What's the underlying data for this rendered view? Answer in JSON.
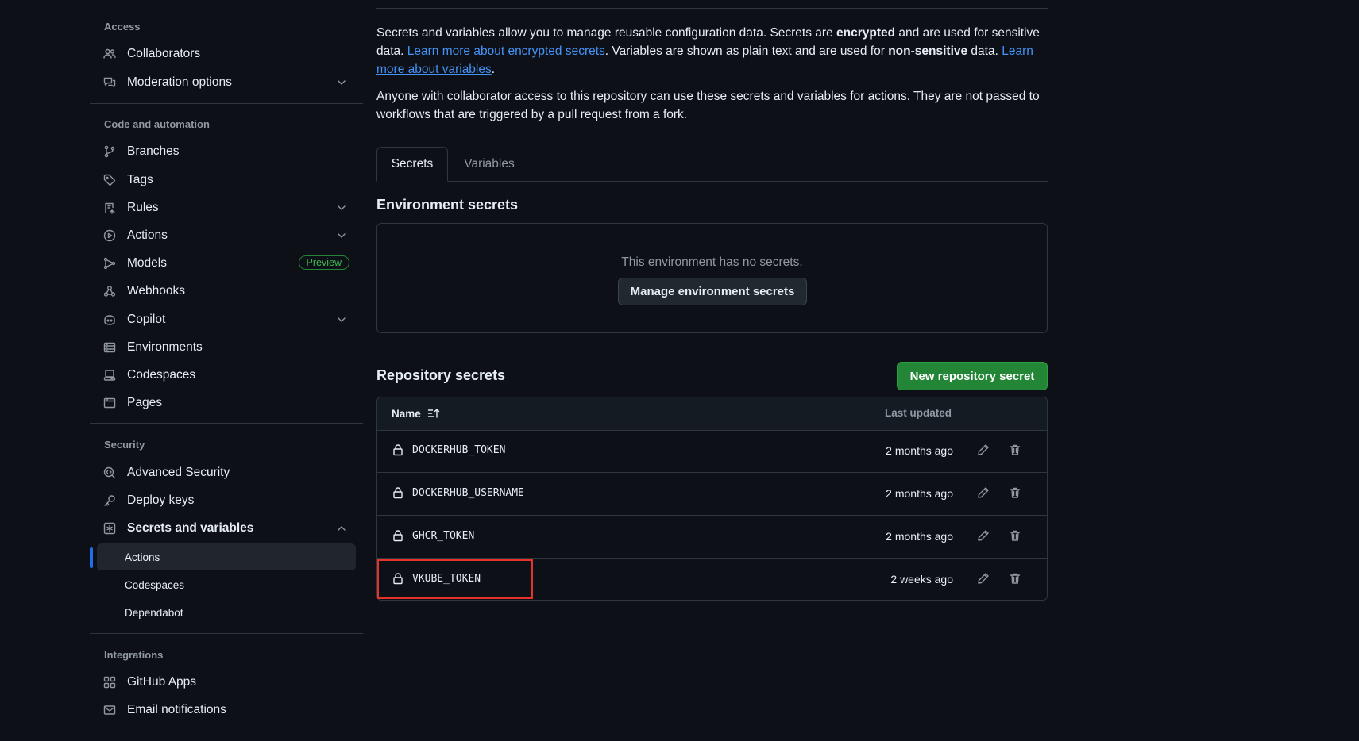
{
  "sidebar": {
    "sections": {
      "access": "Access",
      "code_automation": "Code and automation",
      "security": "Security",
      "integrations": "Integrations"
    },
    "items": {
      "collaborators": "Collaborators",
      "moderation": "Moderation options",
      "branches": "Branches",
      "tags": "Tags",
      "rules": "Rules",
      "actions": "Actions",
      "models": "Models",
      "models_badge": "Preview",
      "webhooks": "Webhooks",
      "copilot": "Copilot",
      "environments": "Environments",
      "codespaces": "Codespaces",
      "pages": "Pages",
      "advanced_security": "Advanced Security",
      "deploy_keys": "Deploy keys",
      "secrets_variables": "Secrets and variables",
      "sub_actions": "Actions",
      "sub_codespaces": "Codespaces",
      "sub_dependabot": "Dependabot",
      "github_apps": "GitHub Apps",
      "email_notifications": "Email notifications"
    }
  },
  "intro": {
    "p1_a": "Secrets and variables allow you to manage reusable configuration data. Secrets are ",
    "p1_b": "encrypted",
    "p1_c": " and are used for sensitive data. ",
    "p1_link1": "Learn more about encrypted secrets",
    "p1_d": ". Variables are shown as plain text and are used for ",
    "p1_e": "non-sensitive",
    "p1_f": " data. ",
    "p1_link2": "Learn more about variables",
    "p1_g": ".",
    "p2": "Anyone with collaborator access to this repository can use these secrets and variables for actions. They are not passed to workflows that are triggered by a pull request from a fork."
  },
  "tabs": {
    "secrets": "Secrets",
    "variables": "Variables"
  },
  "environment": {
    "title": "Environment secrets",
    "empty": "This environment has no secrets.",
    "manage_button": "Manage environment secrets"
  },
  "repository": {
    "title": "Repository secrets",
    "new_button": "New repository secret",
    "columns": {
      "name": "Name",
      "updated": "Last updated"
    },
    "rows": [
      {
        "name": "DOCKERHUB_TOKEN",
        "updated": "2 months ago"
      },
      {
        "name": "DOCKERHUB_USERNAME",
        "updated": "2 months ago"
      },
      {
        "name": "GHCR_TOKEN",
        "updated": "2 months ago"
      },
      {
        "name": "VKUBE_TOKEN",
        "updated": "2 weeks ago"
      }
    ]
  },
  "colors": {
    "accent": "#1f6feb",
    "primary_button": "#238636",
    "link": "#4493f8",
    "highlight": "#e5322d"
  }
}
